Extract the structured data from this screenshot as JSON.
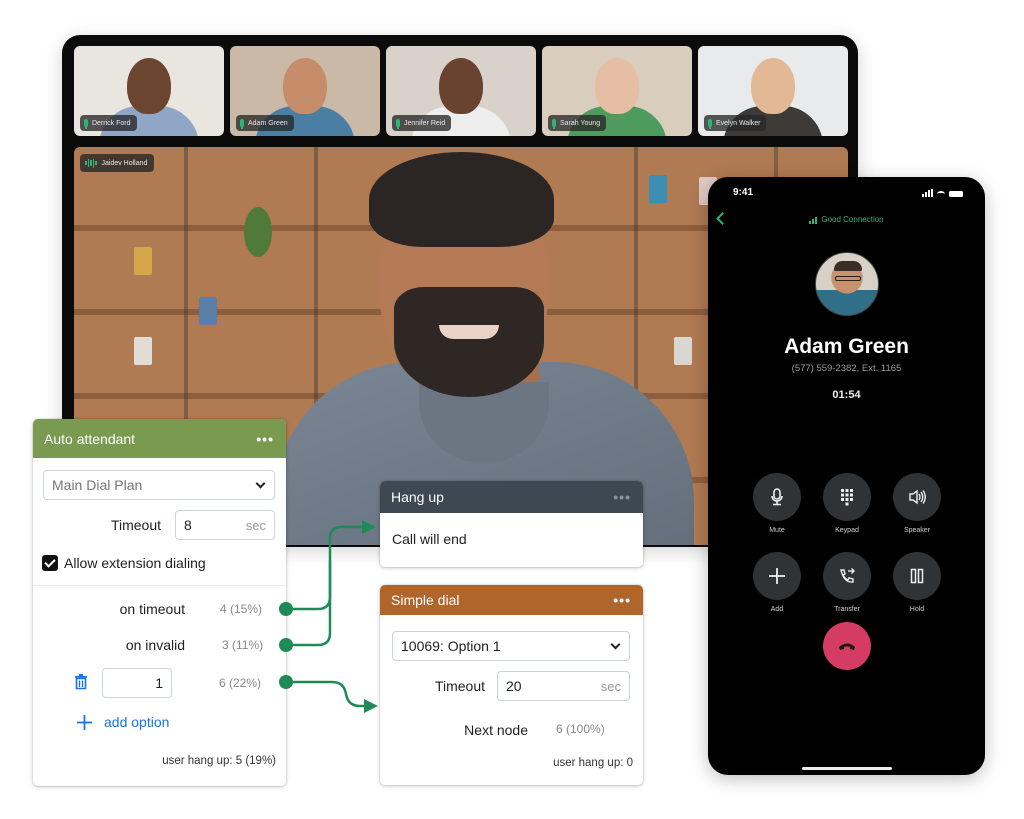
{
  "video_call": {
    "participants": [
      {
        "name": "Derrick Ford",
        "bg": "#e9e5df",
        "skin": "#6b4530",
        "shirt": "#8fa6c6"
      },
      {
        "name": "Adam Green",
        "bg": "#c9b9a6",
        "skin": "#c58d69",
        "shirt": "#4a7fa3"
      },
      {
        "name": "Jennifer Reid",
        "bg": "#d8d2ca",
        "skin": "#6a4330",
        "shirt": "#eeeeee"
      },
      {
        "name": "Sarah Young",
        "bg": "#d9cdbd",
        "skin": "#e5bea3",
        "shirt": "#4f9b5e"
      },
      {
        "name": "Evelyn Walker",
        "bg": "#e8eaec",
        "skin": "#e2b994",
        "shirt": "#3e3a38"
      }
    ],
    "active_speaker": "Jaidev Holland"
  },
  "phone": {
    "status_time": "9:41",
    "connection_status": "Good Connection",
    "caller_name": "Adam Green",
    "caller_number": "(577) 559-2382, Ext. 1165",
    "call_duration": "01:54",
    "controls": [
      {
        "label": "Mute",
        "icon": "microphone-icon"
      },
      {
        "label": "Keypad",
        "icon": "keypad-icon"
      },
      {
        "label": "Speaker",
        "icon": "speaker-icon"
      },
      {
        "label": "Add",
        "icon": "plus-icon"
      },
      {
        "label": "Transfer",
        "icon": "transfer-icon"
      },
      {
        "label": "Hold",
        "icon": "pause-icon"
      }
    ],
    "end_call_icon": "end-call-icon"
  },
  "auto_attendant": {
    "title": "Auto attendant",
    "menu": "•••",
    "dial_plan": "Main Dial Plan",
    "timeout_label": "Timeout",
    "timeout_value": "8",
    "timeout_unit": "sec",
    "allow_extension_label": "Allow extension dialing",
    "allow_extension_checked": true,
    "branches": [
      {
        "label": "on timeout",
        "stat": "4 (15%)"
      },
      {
        "label": "on invalid",
        "stat": "3 (11%)"
      },
      {
        "label": "1",
        "stat": "6 (22%)"
      }
    ],
    "add_option_label": "add option",
    "user_hang_up": "user hang up: 5 (19%)"
  },
  "hang_up": {
    "title": "Hang up",
    "menu": "•••",
    "body": "Call will end"
  },
  "simple_dial": {
    "title": "Simple dial",
    "menu": "•••",
    "option": "10069: Option 1",
    "timeout_label": "Timeout",
    "timeout_value": "20",
    "timeout_unit": "sec",
    "next_node_label": "Next node",
    "next_node_stat": "6 (100%)",
    "user_hang_up": "user hang up: 0"
  },
  "colors": {
    "auto_attendant_header": "#7a9a4f",
    "hang_up_header": "#3e4852",
    "simple_dial_header": "#b0652a",
    "connector": "#1e8a55",
    "link": "#1a73e8",
    "end_call": "#d63b63",
    "good_connection": "#2bb673"
  }
}
